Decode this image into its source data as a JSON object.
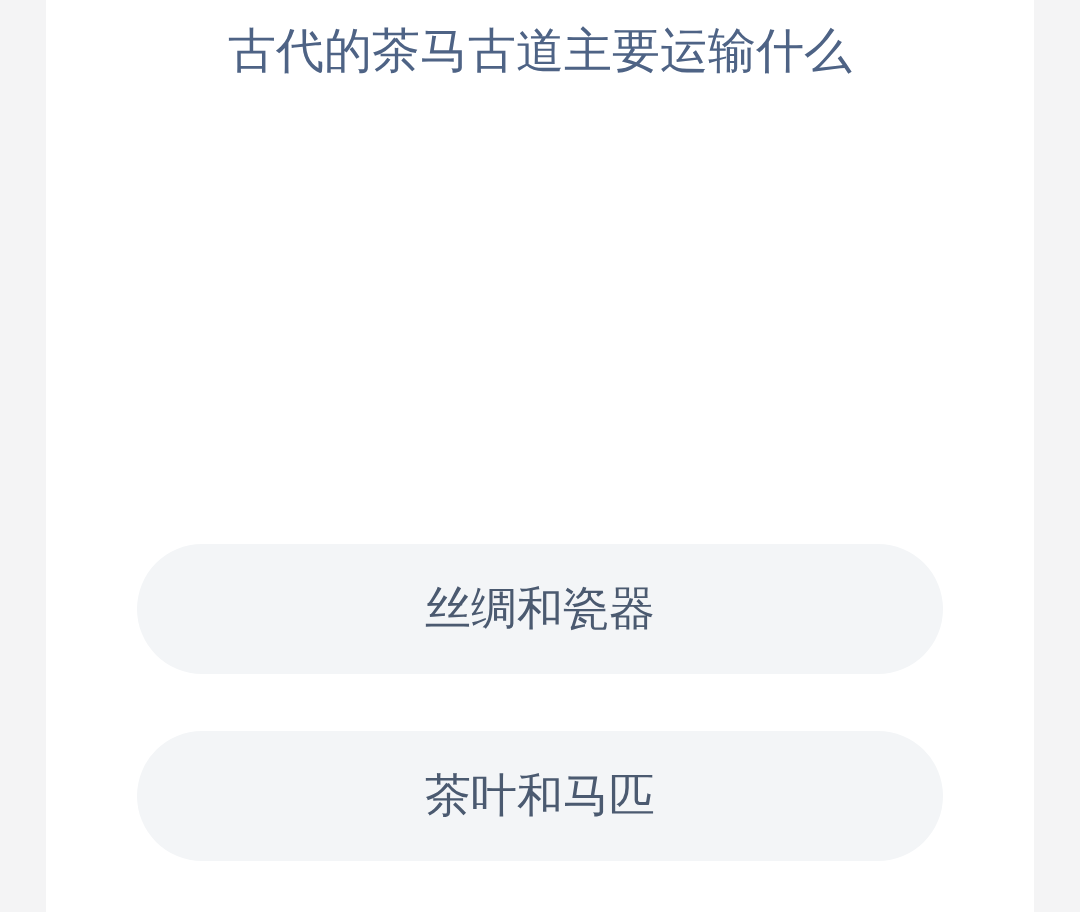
{
  "question": "古代的茶马古道主要运输什么",
  "options": [
    {
      "label": "丝绸和瓷器"
    },
    {
      "label": "茶叶和马匹"
    }
  ]
}
